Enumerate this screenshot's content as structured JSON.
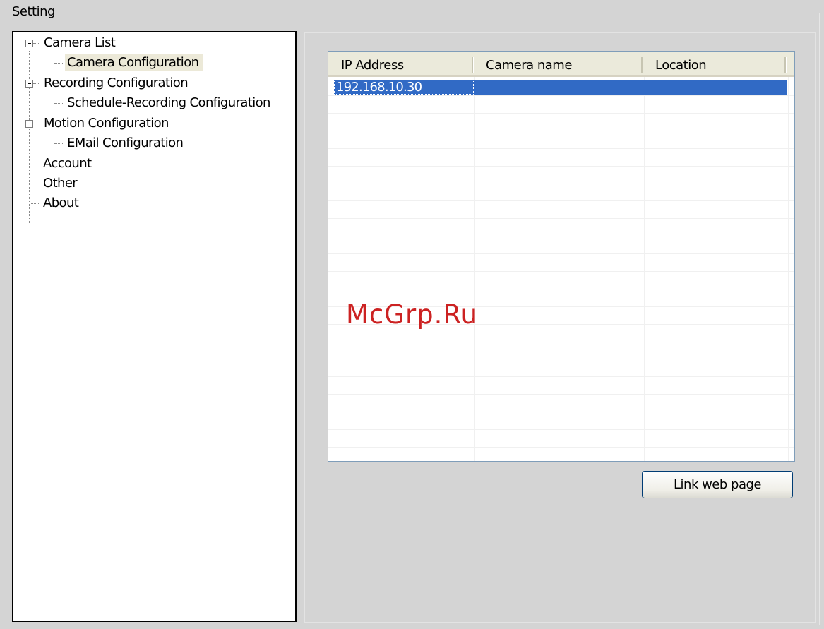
{
  "group": {
    "title": "Setting"
  },
  "tree": {
    "items": [
      {
        "label": "Camera List"
      },
      {
        "label": "Camera Configuration"
      },
      {
        "label": "Recording Configuration"
      },
      {
        "label": "Schedule-Recording Configuration"
      },
      {
        "label": "Motion Configuration"
      },
      {
        "label": "EMail Configuration"
      },
      {
        "label": "Account"
      },
      {
        "label": "Other"
      },
      {
        "label": "About"
      }
    ],
    "selected": "Camera Configuration"
  },
  "camera_table": {
    "columns": [
      "IP Address",
      "Camera name",
      "Location"
    ],
    "rows": [
      [
        "192.168.10.30",
        "",
        ""
      ]
    ],
    "selected_row": 0
  },
  "buttons": {
    "link_web_page": "Link web page"
  },
  "watermark": "McGrp.Ru",
  "colors": {
    "selection": "#316ac5",
    "background": "#d4d4d4",
    "header": "#ebeadb"
  }
}
